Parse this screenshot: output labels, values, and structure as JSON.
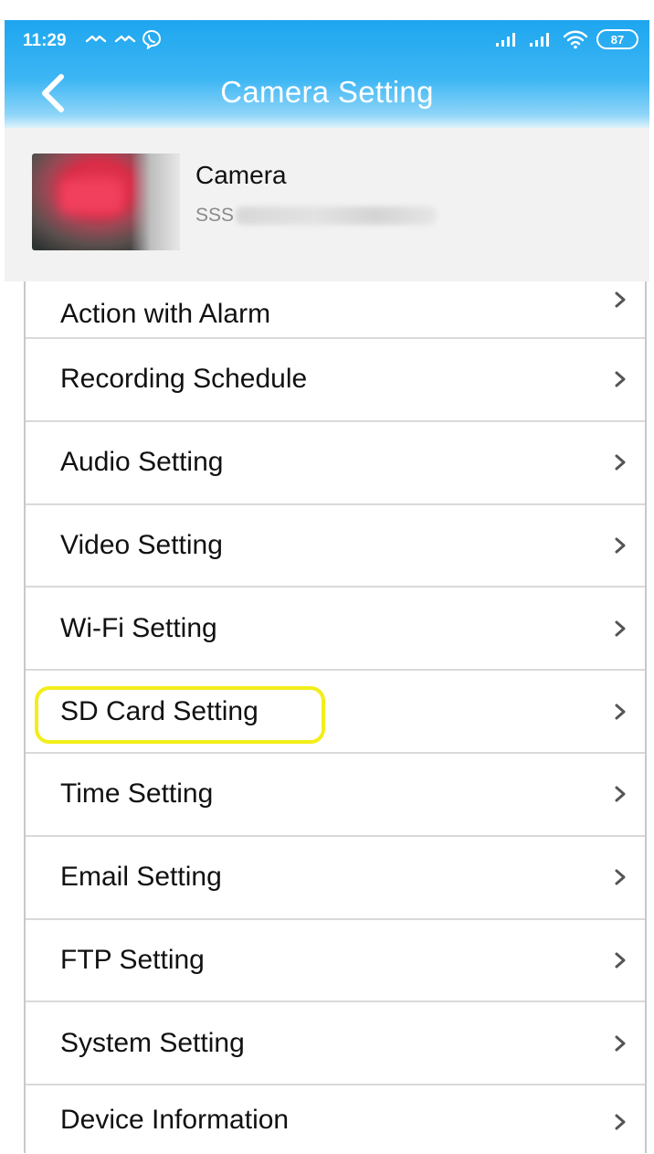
{
  "status_bar": {
    "time": "11:29",
    "battery": "87",
    "notification_icons": [
      "messenger-icon",
      "messenger-icon",
      "viber-icon"
    ],
    "right_icons": [
      "signal-icon",
      "signal-icon",
      "wifi-icon",
      "battery-icon"
    ]
  },
  "header": {
    "title": "Camera Setting",
    "back_icon": "chevron-left-icon"
  },
  "camera": {
    "name": "Camera",
    "id_prefix": "SSS"
  },
  "settings": {
    "items": [
      {
        "label": "Action with Alarm"
      },
      {
        "label": "Recording Schedule"
      },
      {
        "label": "Audio Setting"
      },
      {
        "label": "Video Setting"
      },
      {
        "label": "Wi-Fi Setting"
      },
      {
        "label": "SD Card Setting"
      },
      {
        "label": "Time Setting"
      },
      {
        "label": "Email Setting"
      },
      {
        "label": "FTP Setting"
      },
      {
        "label": "System Setting"
      },
      {
        "label": "Device Information"
      }
    ],
    "highlighted_item": "SD Card Setting",
    "highlight_color": "#f2ee1a"
  },
  "colors": {
    "header_top": "#1ea6ef",
    "header_bottom": "#dff2fb",
    "info_background": "#f2f2f2"
  }
}
